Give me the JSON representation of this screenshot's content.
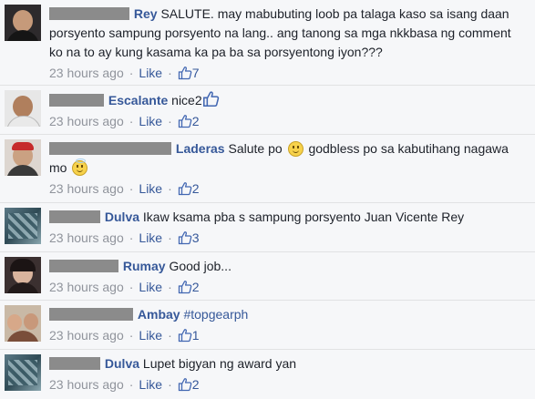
{
  "comments": [
    {
      "name": "Rey",
      "text": "SALUTE. may mabubuting loob pa talaga kaso sa isang daan porsyento sampung porsyento na lang.. ang tanong sa mga nkkbasa ng comment ko na to ay kung kasama ka pa ba sa porsyentong iyon???",
      "time": "23 hours ago",
      "like_label": "Like",
      "likes": "7"
    },
    {
      "name": "Escalante",
      "text": "nice2",
      "time": "23 hours ago",
      "like_label": "Like",
      "likes": "2"
    },
    {
      "name": "Laderas",
      "text_before": "Salute po",
      "text_middle": "godbless po sa kabutihang nagawa mo",
      "time": "23 hours ago",
      "like_label": "Like",
      "likes": "2"
    },
    {
      "name": "Dulva",
      "text": "Ikaw ksama pba s sampung porsyento Juan Vicente Rey",
      "time": "23 hours ago",
      "like_label": "Like",
      "likes": "3"
    },
    {
      "name": "Rumay",
      "text": "Good job...",
      "time": "23 hours ago",
      "like_label": "Like",
      "likes": "2"
    },
    {
      "name": "Ambay",
      "hashtag": "#topgearph",
      "time": "23 hours ago",
      "like_label": "Like",
      "likes": "1"
    },
    {
      "name": "Dulva",
      "text": "Lupet bigyan ng award yan",
      "time": "23 hours ago",
      "like_label": "Like",
      "likes": "2"
    }
  ],
  "colors": {
    "name_link": "#365899",
    "meta_gray": "#90949c",
    "background": "#f6f7f9",
    "redaction": "#8b8b8b"
  },
  "icons": {
    "like_count": "thumbs-up-icon",
    "avatar": "user-avatar-photo",
    "emoticon_smile": "smiley-emoticon",
    "emoticon_angel": "angel-emoticon"
  }
}
